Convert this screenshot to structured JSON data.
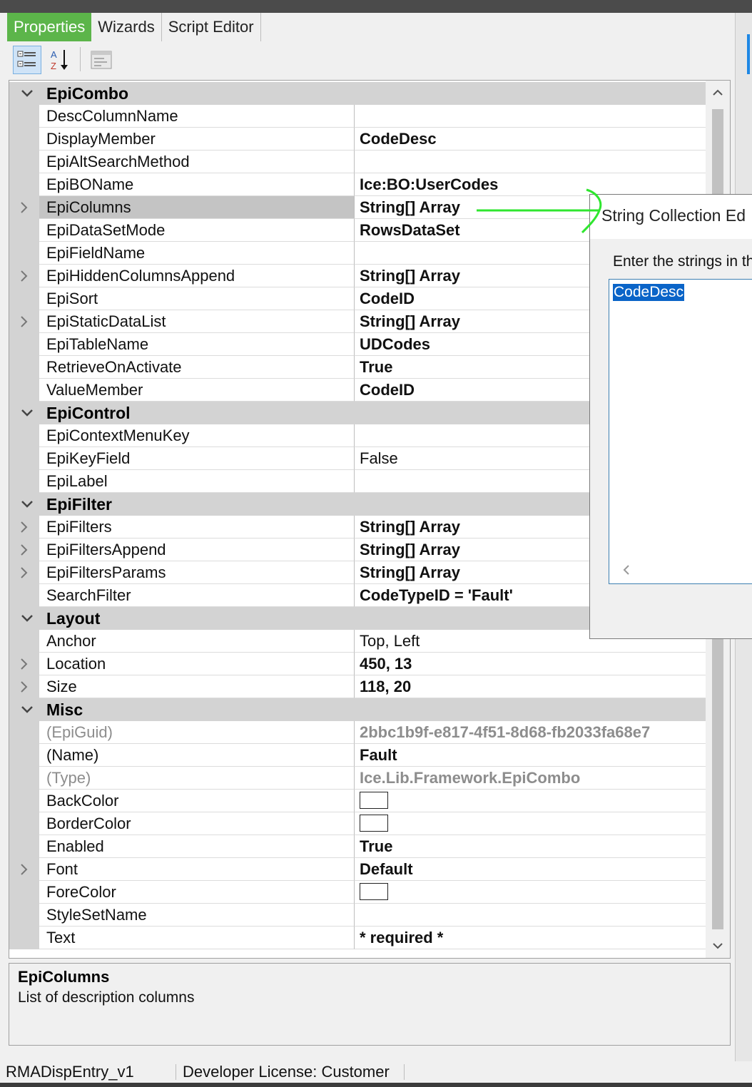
{
  "tabs": [
    {
      "label": "Properties",
      "active": true
    },
    {
      "label": "Wizards",
      "active": false
    },
    {
      "label": "Script Editor",
      "active": false
    }
  ],
  "toolbar": {
    "categorized_icon": "categorized-view-icon",
    "alphabetical_icon": "alphabetical-sort-icon",
    "property_pages_icon": "property-pages-icon"
  },
  "grid": {
    "categories": [
      {
        "name": "EpiCombo",
        "props": [
          {
            "name": "DescColumnName",
            "value": ""
          },
          {
            "name": "DisplayMember",
            "value": "CodeDesc",
            "bold": true
          },
          {
            "name": "EpiAltSearchMethod",
            "value": ""
          },
          {
            "name": "EpiBOName",
            "value": "Ice:BO:UserCodes",
            "bold": true
          },
          {
            "name": "EpiColumns",
            "value": "String[] Array",
            "bold": true,
            "expandable": true,
            "selected": true
          },
          {
            "name": "EpiDataSetMode",
            "value": "RowsDataSet",
            "bold": true
          },
          {
            "name": "EpiFieldName",
            "value": ""
          },
          {
            "name": "EpiHiddenColumnsAppend",
            "value": "String[] Array",
            "bold": true,
            "expandable": true
          },
          {
            "name": "EpiSort",
            "value": "CodeID",
            "bold": true
          },
          {
            "name": "EpiStaticDataList",
            "value": "String[] Array",
            "bold": true,
            "expandable": true
          },
          {
            "name": "EpiTableName",
            "value": "UDCodes",
            "bold": true
          },
          {
            "name": "RetrieveOnActivate",
            "value": "True",
            "bold": true
          },
          {
            "name": "ValueMember",
            "value": "CodeID",
            "bold": true
          }
        ]
      },
      {
        "name": "EpiControl",
        "props": [
          {
            "name": "EpiContextMenuKey",
            "value": ""
          },
          {
            "name": "EpiKeyField",
            "value": "False"
          },
          {
            "name": "EpiLabel",
            "value": ""
          }
        ]
      },
      {
        "name": "EpiFilter",
        "props": [
          {
            "name": "EpiFilters",
            "value": "String[] Array",
            "bold": true,
            "expandable": true
          },
          {
            "name": "EpiFiltersAppend",
            "value": "String[] Array",
            "bold": true,
            "expandable": true
          },
          {
            "name": "EpiFiltersParams",
            "value": "String[] Array",
            "bold": true,
            "expandable": true
          },
          {
            "name": "SearchFilter",
            "value": "CodeTypeID = 'Fault'",
            "bold": true
          }
        ]
      },
      {
        "name": "Layout",
        "props": [
          {
            "name": "Anchor",
            "value": "Top, Left"
          },
          {
            "name": "Location",
            "value": "450, 13",
            "bold": true,
            "expandable": true
          },
          {
            "name": "Size",
            "value": "118, 20",
            "bold": true,
            "expandable": true
          }
        ]
      },
      {
        "name": "Misc",
        "props": [
          {
            "name": "(EpiGuid)",
            "value": "2bbc1b9f-e817-4f51-8d68-fb2033fa68e7",
            "gray": true,
            "bold": true
          },
          {
            "name": "(Name)",
            "value": "Fault",
            "bold": true
          },
          {
            "name": "(Type)",
            "value": "Ice.Lib.Framework.EpiCombo",
            "gray": true,
            "bold": true
          },
          {
            "name": "BackColor",
            "value": "",
            "swatch": "#ffffff"
          },
          {
            "name": "BorderColor",
            "value": "",
            "swatch": "#ffffff"
          },
          {
            "name": "Enabled",
            "value": "True",
            "bold": true
          },
          {
            "name": "Font",
            "value": "Default",
            "bold": true,
            "expandable": true
          },
          {
            "name": "ForeColor",
            "value": "",
            "swatch": "#ffffff"
          },
          {
            "name": "StyleSetName",
            "value": ""
          },
          {
            "name": "Text",
            "value": "* required *",
            "bold": true
          }
        ]
      }
    ]
  },
  "description": {
    "title": "EpiColumns",
    "text": "List of description columns"
  },
  "dialog": {
    "title": "String Collection Ed",
    "prompt": "Enter the strings in th",
    "entries": [
      "CodeDesc"
    ]
  },
  "status": {
    "left": "RMADispEntry_v1",
    "middle": "Developer License:  Customer"
  },
  "colors": {
    "active_tab": "#5cb54a",
    "selection": "#0a64c8",
    "annotation": "#2fe62f",
    "category_bg": "#d3d3d3"
  }
}
